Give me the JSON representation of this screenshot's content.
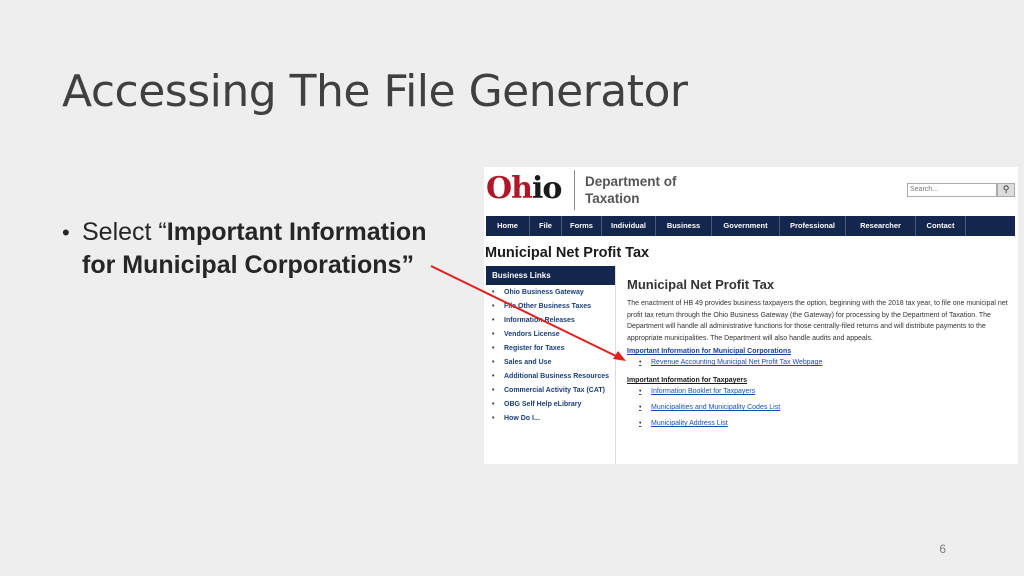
{
  "slide": {
    "title": "Accessing The File Generator",
    "bullet_prefix": "Select “",
    "bullet_bold": "Important Information for Municipal Corporations",
    "bullet_suffix": "”",
    "page_number": "6"
  },
  "screenshot": {
    "logo": {
      "oh": "Oh",
      "io": "io"
    },
    "dept_line1": "Department of",
    "dept_line2": "Taxation",
    "search_placeholder": "Search...",
    "nav": [
      "Home",
      "File",
      "Forms",
      "Individual",
      "Business",
      "Government",
      "Professional",
      "Researcher",
      "Contact"
    ],
    "page_heading": "Municipal Net Profit Tax",
    "sidebar": {
      "heading": "Business Links",
      "items": [
        "Ohio Business Gateway",
        "File Other Business Taxes",
        "Information Releases",
        "Vendors License",
        "Register for Taxes",
        "Sales and Use",
        "Additional Business Resources",
        "Commercial Activity Tax (CAT)",
        "OBG Self Help eLibrary",
        "How Do I..."
      ]
    },
    "main": {
      "title": "Municipal Net Profit Tax",
      "paragraph": "The enactment of HB 49 provides business taxpayers the option, beginning with the 2018 tax year, to file one municipal net profit tax return through the Ohio Business Gateway (the Gateway) for processing by the Department of Taxation. The Department will handle all administrative functions for those centrally-filed returns and will distribute payments to the appropriate municipalities. The Department will also handle audits and appeals.",
      "corp_heading": "Important Information for Municipal Corporations",
      "corp_links": [
        "Revenue Accounting Municipal Net Profit Tax Webpage"
      ],
      "taxpayer_heading": "Important Information for Taxpayers",
      "taxpayer_links": [
        "Information Booklet for Taxpayers",
        "Municipalities and Municipality Codes List",
        "Municipality Address List"
      ]
    }
  },
  "colors": {
    "nav_bg": "#13264e",
    "ohio_red": "#b0172b",
    "arrow": "#e02020",
    "link": "#1a4fb0"
  }
}
